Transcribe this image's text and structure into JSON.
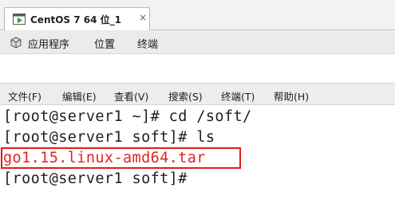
{
  "vm_tab": {
    "icon": "vm-play-icon",
    "title": "CentOS 7 64 位_1",
    "close": "×"
  },
  "top_panel": {
    "app_icon": "applications-icon",
    "items": [
      "应用程序",
      "位置",
      "终端"
    ]
  },
  "terminal_menu": {
    "items": [
      "文件(F)",
      "编辑(E)",
      "查看(V)",
      "搜索(S)",
      "终端(T)",
      "帮助(H)"
    ]
  },
  "terminal": {
    "lines": [
      "[root@server1 ~]# cd /soft/",
      "[root@server1 soft]# ls",
      "go1.15.linux-amd64.tar",
      "[root@server1 soft]#"
    ],
    "highlight_color": "#e01b1b",
    "file_color": "#e32222"
  }
}
